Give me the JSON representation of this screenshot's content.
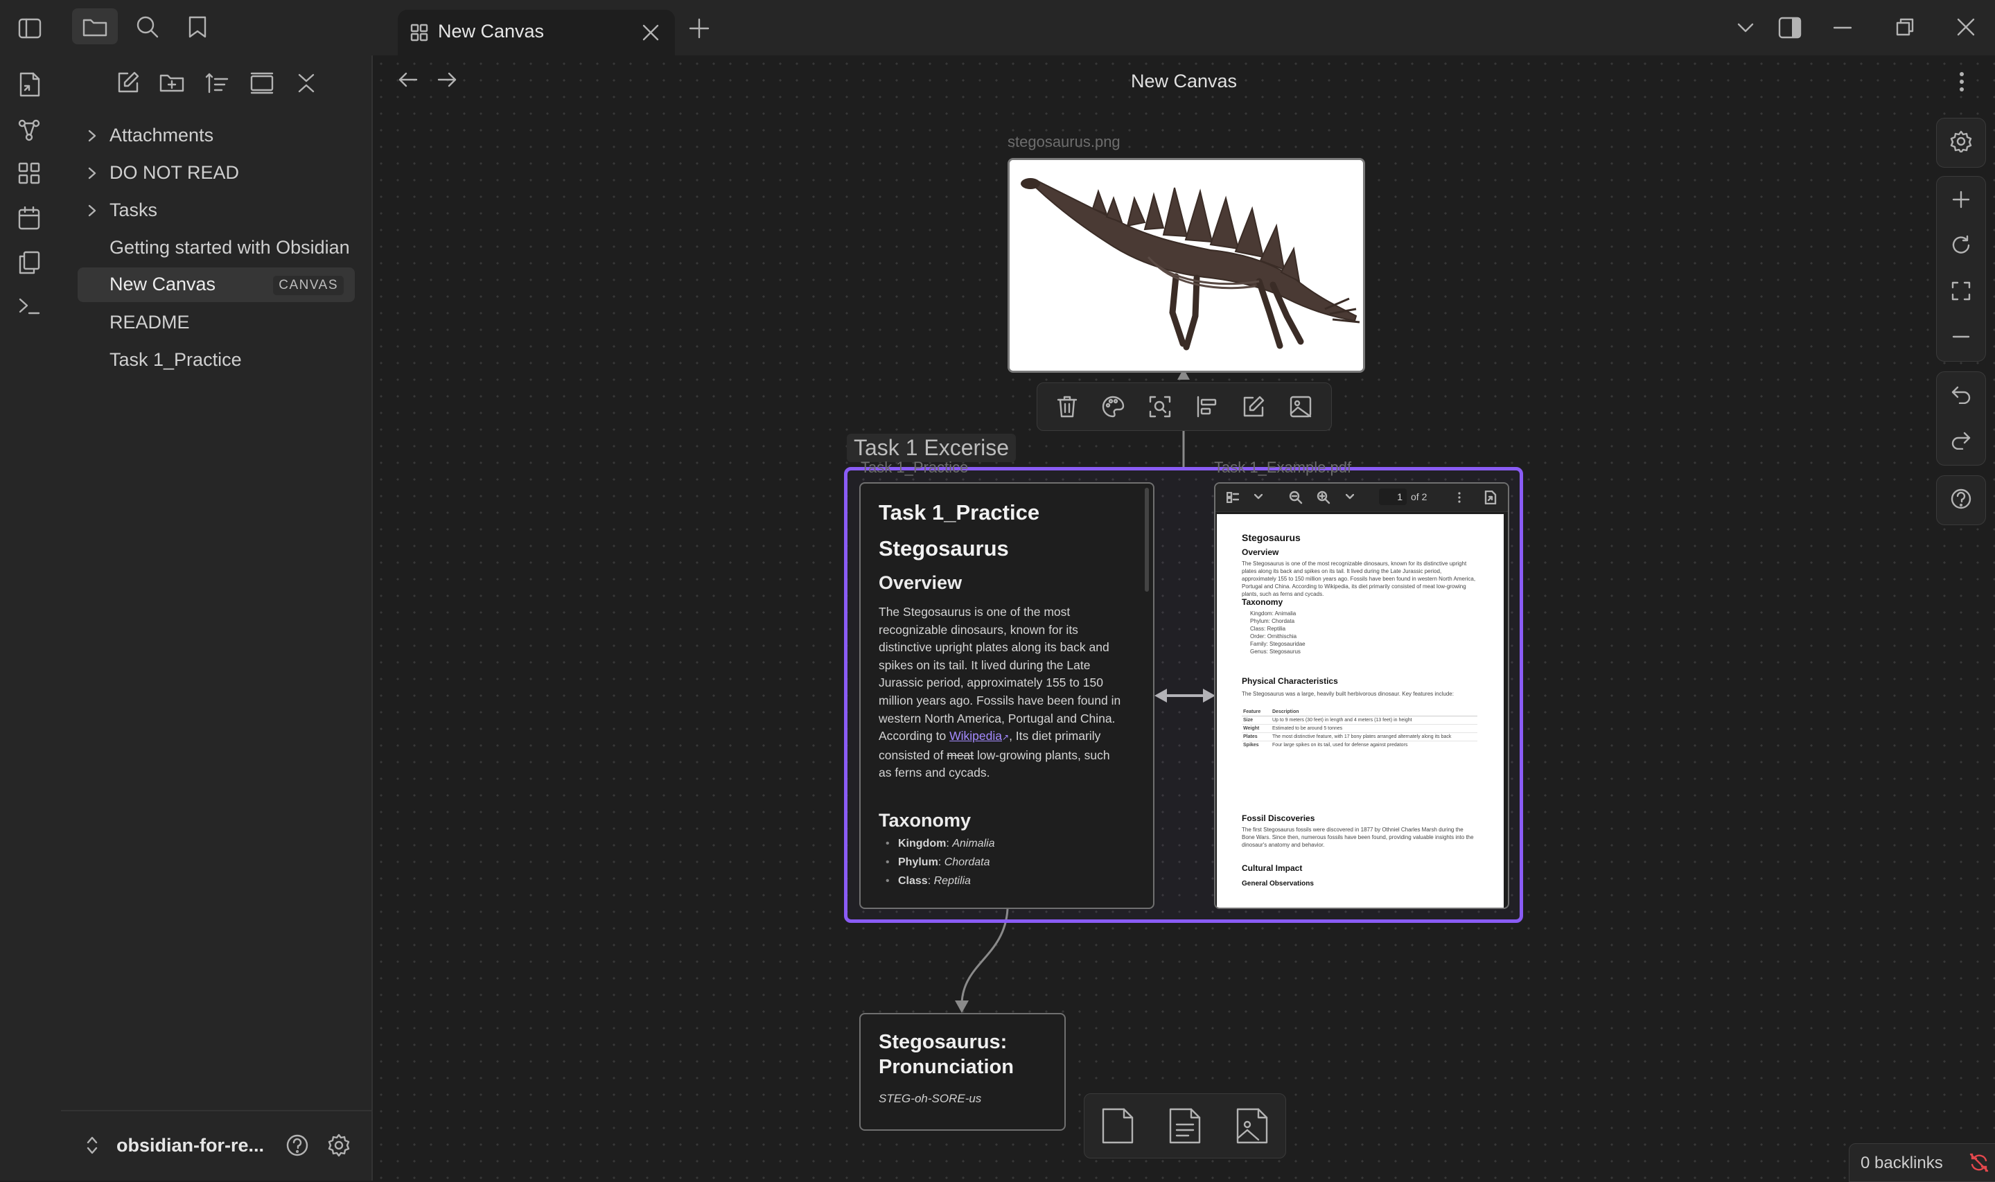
{
  "tab": {
    "title": "New Canvas"
  },
  "view": {
    "title": "New Canvas"
  },
  "sidebar": {
    "items": [
      {
        "label": "Attachments",
        "folder": true
      },
      {
        "label": "DO NOT READ",
        "folder": true
      },
      {
        "label": "Tasks",
        "folder": true
      },
      {
        "label": "Getting started with Obsidian"
      },
      {
        "label": "New Canvas",
        "badge": "CANVAS",
        "active": true
      },
      {
        "label": "README"
      },
      {
        "label": "Task 1_Practice"
      }
    ],
    "vault_name": "obsidian-for-re..."
  },
  "canvas": {
    "image_node": {
      "label": "stegosaurus.png"
    },
    "group": {
      "label": "Task 1 Excerise"
    },
    "note_node": {
      "label": "Task 1_Practice",
      "title": "Task 1_Practice",
      "heading": "Stegosaurus",
      "overview_heading": "Overview",
      "overview_text_1": "The Stegosaurus is one of the most recognizable dinosaurs, known for its distinctive upright plates along its back and spikes on its tail. It lived during the Late Jurassic period, approximately 155 to 150 million years ago. Fossils have been found in western North America, Portugal and China. According to ",
      "overview_link": "Wikipedia",
      "overview_text_2": ", Its diet primarily consisted of ",
      "overview_strike": "meat",
      "overview_text_3": " low-growing plants, such as ferns and cycads.",
      "taxonomy_heading": "Taxonomy",
      "taxonomy": [
        {
          "key": "Kingdom",
          "value": "Animalia"
        },
        {
          "key": "Phylum",
          "value": "Chordata"
        },
        {
          "key": "Class",
          "value": "Reptilia"
        }
      ]
    },
    "pdf_node": {
      "label": "Task 1_Example.pdf",
      "page_current": "1",
      "page_total": "of 2",
      "title": "Stegosaurus",
      "overview": "Overview",
      "overview_text": "The Stegosaurus is one of the most recognizable dinosaurs, known for its distinctive upright plates along its back and spikes on its tail. It lived during the Late Jurassic period, approximately 155 to 150 million years ago. Fossils have been found in western North America, Portugal and China. According to Wikipedia, its diet primarily consisted of meat low-growing plants, such as ferns and cycads.",
      "taxonomy": "Taxonomy",
      "taxonomy_items": [
        "Kingdom: Animalia",
        "Phylum: Chordata",
        "Class: Reptilia",
        "Order: Ornithischia",
        "Family: Stegosauridae",
        "Genus: Stegosaurus"
      ],
      "physical": "Physical Characteristics",
      "physical_text": "The Stegosaurus was a large, heavily built herbivorous dinosaur. Key features include:",
      "table_header": [
        "Feature",
        "Description"
      ],
      "table_rows": [
        [
          "Size",
          "Up to 9 meters (30 feet) in length and 4 meters (13 feet) in height"
        ],
        [
          "Weight",
          "Estimated to be around 5 tonnes"
        ],
        [
          "Plates",
          "The most distinctive feature, with 17 bony plates arranged alternately along its back"
        ],
        [
          "Spikes",
          "Four large spikes on its tail, used for defense against predators"
        ]
      ],
      "fossil": "Fossil Discoveries",
      "fossil_text": "The first Stegosaurus fossils were discovered in 1877 by Othniel Charles Marsh during the Bone Wars. Since then, numerous fossils have been found, providing valuable insights into the dinosaur's anatomy and behavior.",
      "cultural": "Cultural Impact",
      "general": "General Observations"
    },
    "pronunciation_node": {
      "title": "Stegosaurus: Pronunciation",
      "text": "STEG-oh-SORE-us"
    }
  },
  "status": {
    "backlinks": "0 backlinks"
  },
  "colors": {
    "accent": "#8a5cf5",
    "background": "#1e1e1e",
    "panel": "#262626",
    "link": "#a58bff",
    "sync_error": "#e5484d"
  }
}
